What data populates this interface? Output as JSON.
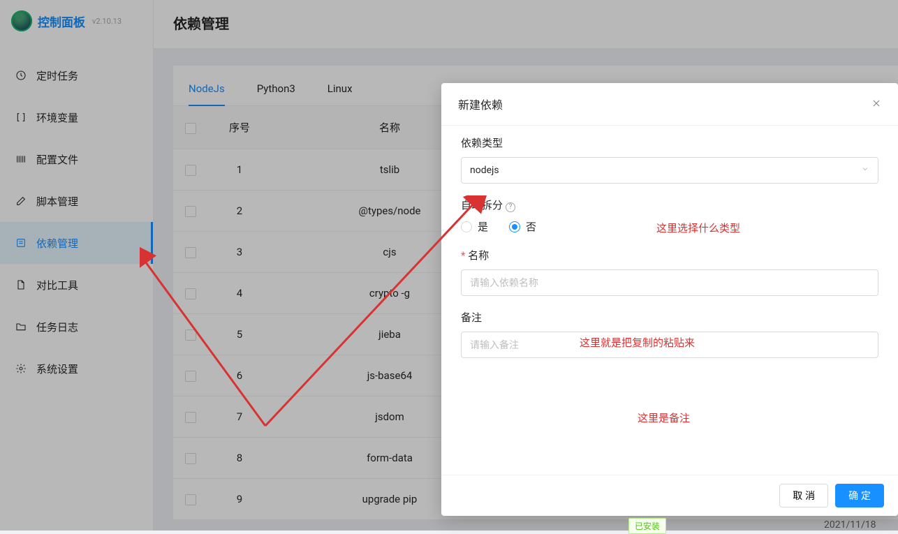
{
  "brand": {
    "title": "控制面板",
    "version": "v2.10.13"
  },
  "nav": [
    {
      "label": "定时任务",
      "icon": "clock"
    },
    {
      "label": "环境变量",
      "icon": "brackets"
    },
    {
      "label": "配置文件",
      "icon": "barcode"
    },
    {
      "label": "脚本管理",
      "icon": "edit"
    },
    {
      "label": "依赖管理",
      "icon": "layers",
      "active": true
    },
    {
      "label": "对比工具",
      "icon": "file"
    },
    {
      "label": "任务日志",
      "icon": "folder"
    },
    {
      "label": "系统设置",
      "icon": "gear"
    }
  ],
  "page": {
    "title": "依赖管理"
  },
  "tabs": [
    {
      "label": "NodeJs",
      "active": true
    },
    {
      "label": "Python3"
    },
    {
      "label": "Linux"
    }
  ],
  "columns": {
    "idx": "序号",
    "name": "名称"
  },
  "rows": [
    {
      "idx": "1",
      "name": "tslib"
    },
    {
      "idx": "2",
      "name": "@types/node"
    },
    {
      "idx": "3",
      "name": "cjs"
    },
    {
      "idx": "4",
      "name": "crypto -g"
    },
    {
      "idx": "5",
      "name": "jieba"
    },
    {
      "idx": "6",
      "name": "js-base64"
    },
    {
      "idx": "7",
      "name": "jsdom"
    },
    {
      "idx": "8",
      "name": "form-data"
    },
    {
      "idx": "9",
      "name": "upgrade pip"
    }
  ],
  "status_badge": "已安装",
  "partial_date": "2021/11/18",
  "modal": {
    "title": "新建依赖",
    "type_label": "依赖类型",
    "type_value": "nodejs",
    "split_label": "自动拆分",
    "radio_yes": "是",
    "radio_no": "否",
    "radio_selected": "no",
    "name_label": "名称",
    "name_placeholder": "请输入依赖名称",
    "remark_label": "备注",
    "remark_placeholder": "请输入备注",
    "cancel": "取 消",
    "ok": "确 定"
  },
  "annotations": {
    "a1": "这里选择什么类型",
    "a2": "这里就是把复制的粘贴来",
    "a3": "这里是备注"
  }
}
